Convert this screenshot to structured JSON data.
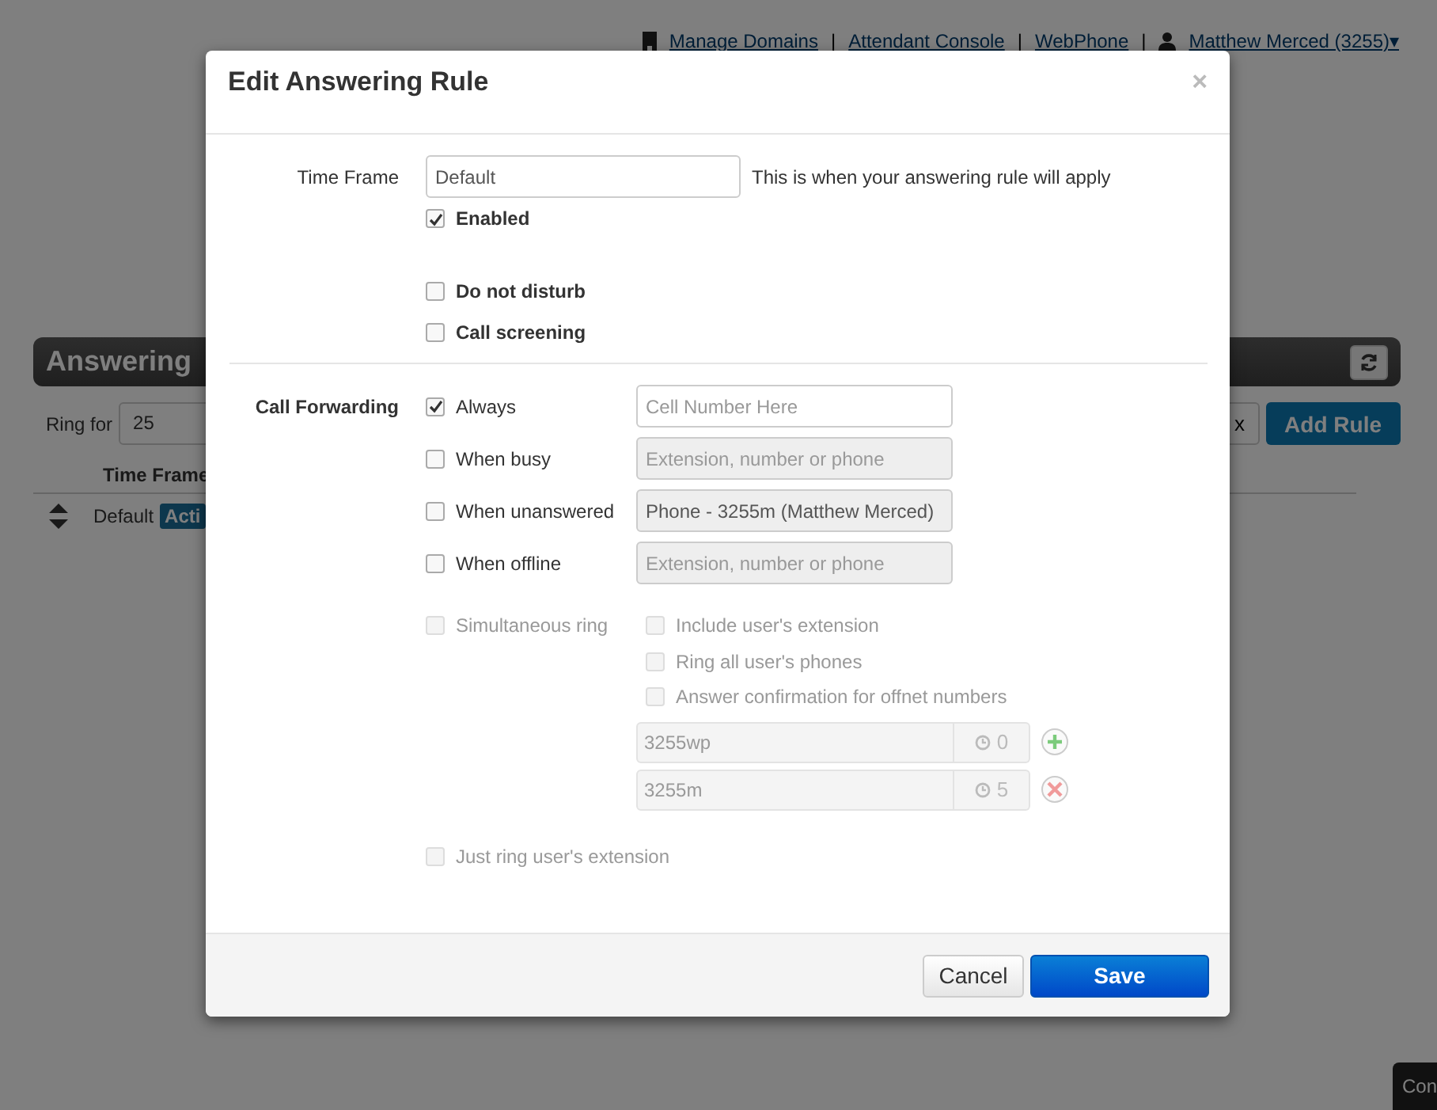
{
  "page": {
    "header_links": [
      {
        "text": "Manage Domains"
      },
      {
        "text": "Attendant Console"
      },
      {
        "text": "WebPhone"
      }
    ],
    "separator": "|",
    "user_menu": "Matthew Merced (3255)",
    "user_caret": "▾",
    "panel_title": "Answering",
    "ring_for": {
      "label": "Ring for",
      "value": "25"
    },
    "table_header": "Time Frame",
    "row": {
      "name": "Default",
      "badge": "Acti"
    },
    "partial_button": "x",
    "add_button": "Add Rule",
    "corner_tab": "Con"
  },
  "modal": {
    "title": "Edit Answering Rule",
    "close": "×",
    "time_frame": {
      "label": "Time Frame",
      "value": "Default",
      "hint": "This is when your answering rule will apply"
    },
    "options": [
      {
        "label": "Enabled",
        "checked": true
      },
      {
        "label": "Do not disturb",
        "checked": false
      },
      {
        "label": "Call screening",
        "checked": false
      }
    ],
    "forwarding": {
      "label": "Call Forwarding",
      "rows": [
        {
          "label": "Always",
          "checked": true,
          "input": {
            "placeholder": "Cell Number Here",
            "disabled": false
          }
        },
        {
          "label": "When busy",
          "checked": false,
          "input": {
            "placeholder": "Extension, number or phone",
            "disabled": true
          }
        },
        {
          "label": "When unanswered",
          "checked": false,
          "input": {
            "value": "Phone - 3255m (Matthew Merced)",
            "disabled": true
          }
        },
        {
          "label": "When offline",
          "checked": false,
          "input": {
            "placeholder": "Extension, number or phone",
            "disabled": true
          }
        }
      ]
    },
    "simultaneous": {
      "label": "Simultaneous ring",
      "checked": false,
      "disabled": true,
      "sub_options": [
        {
          "label": "Include user's extension",
          "checked": false,
          "disabled": true
        },
        {
          "label": "Ring all user's phones",
          "checked": false,
          "disabled": true
        },
        {
          "label": "Answer confirmation for offnet numbers",
          "checked": false,
          "disabled": true
        }
      ],
      "entries": [
        {
          "value": "3255wp",
          "delay": "0",
          "kind": "add"
        },
        {
          "value": "3255m",
          "delay": "5",
          "kind": "remove"
        }
      ]
    },
    "just_ring": {
      "label": "Just ring user's extension",
      "checked": false,
      "disabled": true
    },
    "buttons": [
      {
        "label": "Cancel",
        "kind": "default"
      },
      {
        "label": "Save",
        "kind": "primary"
      }
    ]
  }
}
